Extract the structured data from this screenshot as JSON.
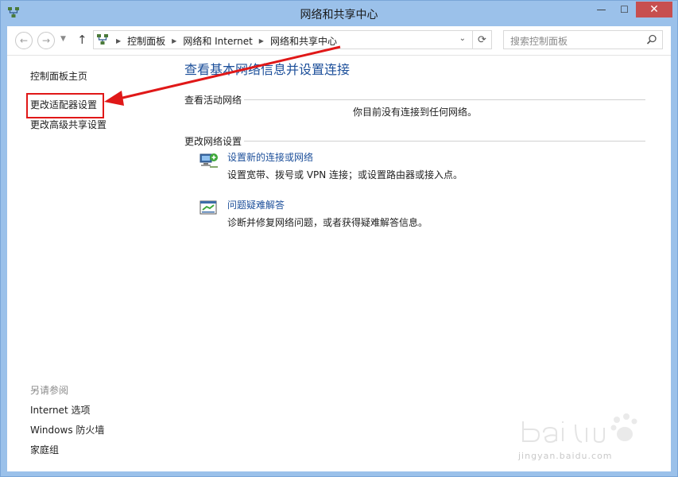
{
  "window": {
    "title": "网络和共享中心",
    "controls": {
      "minimize": "—",
      "maximize": "☐",
      "close": "✕"
    }
  },
  "nav": {
    "back_icon": "back-arrow-icon",
    "forward_icon": "forward-arrow-icon",
    "up_icon": "up-arrow-icon",
    "breadcrumbs": [
      "控制面板",
      "网络和 Internet",
      "网络和共享中心"
    ],
    "search_placeholder": "搜索控制面板"
  },
  "sidebar": {
    "items": [
      "控制面板主页",
      "更改适配器设置",
      "更改高级共享设置"
    ],
    "see_also_label": "另请参阅",
    "see_also_items": [
      "Internet 选项",
      "Windows 防火墙",
      "家庭组"
    ]
  },
  "main": {
    "title": "查看基本网络信息并设置连接",
    "active_networks_label": "查看活动网络",
    "no_connection_text": "你目前没有连接到任何网络。",
    "change_settings_label": "更改网络设置",
    "tasks": [
      {
        "link": "设置新的连接或网络",
        "desc": "设置宽带、拨号或 VPN 连接；或设置路由器或接入点。",
        "icon": "network-setup-icon"
      },
      {
        "link": "问题疑难解答",
        "desc": "诊断并修复网络问题，或者获得疑难解答信息。",
        "icon": "troubleshoot-icon"
      }
    ]
  },
  "watermark": {
    "text": "jingyan.baidu.com"
  },
  "colors": {
    "frame": "#9bc1ea",
    "link": "#1c4f9a",
    "annotation": "#e01818",
    "close_button": "#c74f4f"
  }
}
